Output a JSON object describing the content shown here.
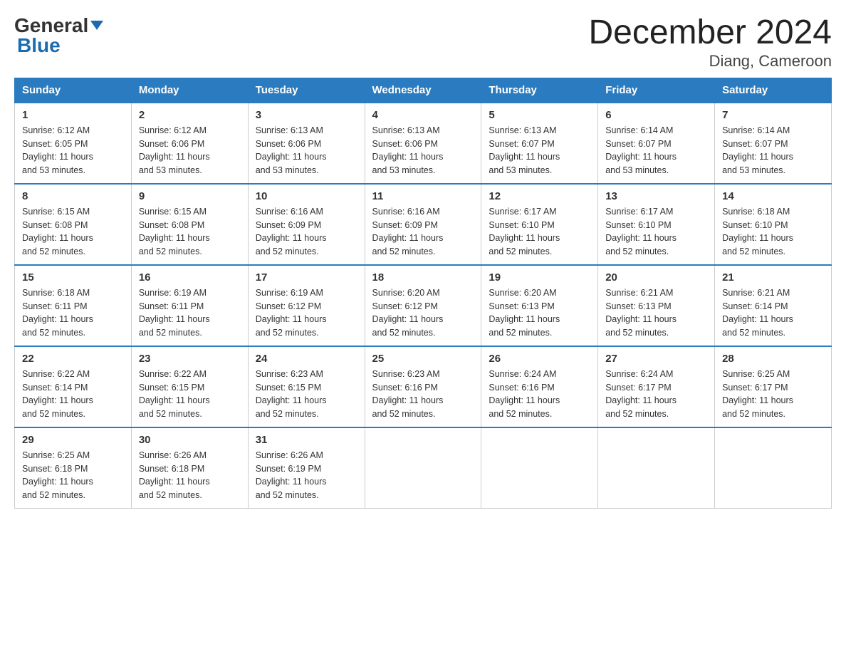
{
  "header": {
    "logo_general": "General",
    "logo_blue": "Blue",
    "title": "December 2024",
    "subtitle": "Diang, Cameroon"
  },
  "days_of_week": [
    "Sunday",
    "Monday",
    "Tuesday",
    "Wednesday",
    "Thursday",
    "Friday",
    "Saturday"
  ],
  "weeks": [
    [
      {
        "day": "1",
        "sunrise": "6:12 AM",
        "sunset": "6:05 PM",
        "daylight": "11 hours and 53 minutes."
      },
      {
        "day": "2",
        "sunrise": "6:12 AM",
        "sunset": "6:06 PM",
        "daylight": "11 hours and 53 minutes."
      },
      {
        "day": "3",
        "sunrise": "6:13 AM",
        "sunset": "6:06 PM",
        "daylight": "11 hours and 53 minutes."
      },
      {
        "day": "4",
        "sunrise": "6:13 AM",
        "sunset": "6:06 PM",
        "daylight": "11 hours and 53 minutes."
      },
      {
        "day": "5",
        "sunrise": "6:13 AM",
        "sunset": "6:07 PM",
        "daylight": "11 hours and 53 minutes."
      },
      {
        "day": "6",
        "sunrise": "6:14 AM",
        "sunset": "6:07 PM",
        "daylight": "11 hours and 53 minutes."
      },
      {
        "day": "7",
        "sunrise": "6:14 AM",
        "sunset": "6:07 PM",
        "daylight": "11 hours and 53 minutes."
      }
    ],
    [
      {
        "day": "8",
        "sunrise": "6:15 AM",
        "sunset": "6:08 PM",
        "daylight": "11 hours and 52 minutes."
      },
      {
        "day": "9",
        "sunrise": "6:15 AM",
        "sunset": "6:08 PM",
        "daylight": "11 hours and 52 minutes."
      },
      {
        "day": "10",
        "sunrise": "6:16 AM",
        "sunset": "6:09 PM",
        "daylight": "11 hours and 52 minutes."
      },
      {
        "day": "11",
        "sunrise": "6:16 AM",
        "sunset": "6:09 PM",
        "daylight": "11 hours and 52 minutes."
      },
      {
        "day": "12",
        "sunrise": "6:17 AM",
        "sunset": "6:10 PM",
        "daylight": "11 hours and 52 minutes."
      },
      {
        "day": "13",
        "sunrise": "6:17 AM",
        "sunset": "6:10 PM",
        "daylight": "11 hours and 52 minutes."
      },
      {
        "day": "14",
        "sunrise": "6:18 AM",
        "sunset": "6:10 PM",
        "daylight": "11 hours and 52 minutes."
      }
    ],
    [
      {
        "day": "15",
        "sunrise": "6:18 AM",
        "sunset": "6:11 PM",
        "daylight": "11 hours and 52 minutes."
      },
      {
        "day": "16",
        "sunrise": "6:19 AM",
        "sunset": "6:11 PM",
        "daylight": "11 hours and 52 minutes."
      },
      {
        "day": "17",
        "sunrise": "6:19 AM",
        "sunset": "6:12 PM",
        "daylight": "11 hours and 52 minutes."
      },
      {
        "day": "18",
        "sunrise": "6:20 AM",
        "sunset": "6:12 PM",
        "daylight": "11 hours and 52 minutes."
      },
      {
        "day": "19",
        "sunrise": "6:20 AM",
        "sunset": "6:13 PM",
        "daylight": "11 hours and 52 minutes."
      },
      {
        "day": "20",
        "sunrise": "6:21 AM",
        "sunset": "6:13 PM",
        "daylight": "11 hours and 52 minutes."
      },
      {
        "day": "21",
        "sunrise": "6:21 AM",
        "sunset": "6:14 PM",
        "daylight": "11 hours and 52 minutes."
      }
    ],
    [
      {
        "day": "22",
        "sunrise": "6:22 AM",
        "sunset": "6:14 PM",
        "daylight": "11 hours and 52 minutes."
      },
      {
        "day": "23",
        "sunrise": "6:22 AM",
        "sunset": "6:15 PM",
        "daylight": "11 hours and 52 minutes."
      },
      {
        "day": "24",
        "sunrise": "6:23 AM",
        "sunset": "6:15 PM",
        "daylight": "11 hours and 52 minutes."
      },
      {
        "day": "25",
        "sunrise": "6:23 AM",
        "sunset": "6:16 PM",
        "daylight": "11 hours and 52 minutes."
      },
      {
        "day": "26",
        "sunrise": "6:24 AM",
        "sunset": "6:16 PM",
        "daylight": "11 hours and 52 minutes."
      },
      {
        "day": "27",
        "sunrise": "6:24 AM",
        "sunset": "6:17 PM",
        "daylight": "11 hours and 52 minutes."
      },
      {
        "day": "28",
        "sunrise": "6:25 AM",
        "sunset": "6:17 PM",
        "daylight": "11 hours and 52 minutes."
      }
    ],
    [
      {
        "day": "29",
        "sunrise": "6:25 AM",
        "sunset": "6:18 PM",
        "daylight": "11 hours and 52 minutes."
      },
      {
        "day": "30",
        "sunrise": "6:26 AM",
        "sunset": "6:18 PM",
        "daylight": "11 hours and 52 minutes."
      },
      {
        "day": "31",
        "sunrise": "6:26 AM",
        "sunset": "6:19 PM",
        "daylight": "11 hours and 52 minutes."
      },
      null,
      null,
      null,
      null
    ]
  ],
  "labels": {
    "sunrise": "Sunrise:",
    "sunset": "Sunset:",
    "daylight": "Daylight: 11 hours"
  }
}
